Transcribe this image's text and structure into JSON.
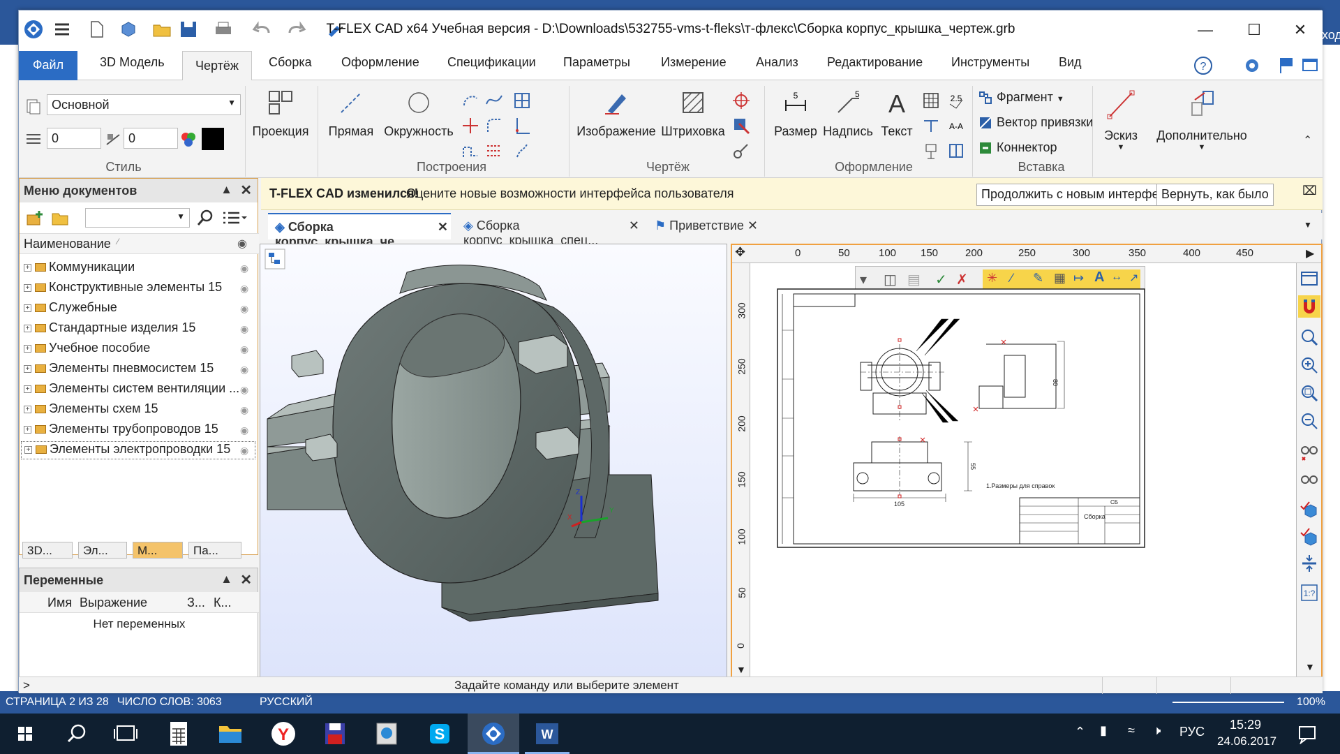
{
  "word": {
    "status_page": "СТРАНИЦА 2 ИЗ 28",
    "status_words": "ЧИСЛО СЛОВ: 3063",
    "status_lang": "РУССКИЙ",
    "zoom": "100%",
    "right_fragment": "ход"
  },
  "app": {
    "title": "T-FLEX CAD x64 Учебная версия - D:\\Downloads\\532755-vms-t-fleks\\т-флекс\\Сборка корпус_крышка_чертеж.grb"
  },
  "menu_tabs": [
    "Файл",
    "3D Модель",
    "Чертёж",
    "Сборка",
    "Оформление",
    "Спецификации",
    "Параметры",
    "Измерение",
    "Анализ",
    "Редактирование",
    "Инструменты",
    "Вид"
  ],
  "ribbon": {
    "style_combo": "Основной",
    "spin1": "0",
    "spin2": "0",
    "group_style": "Стиль",
    "projection": "Проекция",
    "line": "Прямая",
    "circle": "Окружность",
    "group_build": "Построения",
    "image": "Изображение",
    "hatch": "Штриховка",
    "group_drawing": "Чертёж",
    "size": "Размер",
    "label": "Надпись",
    "text": "Текст",
    "group_format": "Оформление",
    "fragment": "Фрагмент",
    "vector": "Вектор привязки",
    "connector": "Коннектор",
    "group_insert": "Вставка",
    "sketch": "Эскиз",
    "more": "Дополнительно"
  },
  "notify": {
    "bold": "T-FLEX CAD изменился!",
    "text": "Оцените новые возможности интерфейса пользователя",
    "btn_continue": "Продолжить с новым интерфейсом",
    "btn_revert": "Вернуть, как было"
  },
  "doc_tabs": [
    "Сборка корпус_крышка_че...",
    "Сборка корпус_крышка_спец...",
    "Приветствие"
  ],
  "docs_panel": {
    "title": "Меню документов",
    "col_name": "Наименование",
    "items": [
      "Коммуникации",
      "Конструктивные элементы 15",
      "Служебные",
      "Стандартные изделия 15",
      "Учебное пособие",
      "Элементы пневмосистем 15",
      "Элементы систем вентиляции ...",
      "Элементы схем 15",
      "Элементы трубопроводов 15",
      "Элементы электропроводки 15"
    ],
    "bottom_tabs": [
      "3D...",
      "Эл...",
      "М...",
      "Па..."
    ]
  },
  "vars_panel": {
    "title": "Переменные",
    "cols": [
      "Имя",
      "Выражение",
      "З...",
      "К..."
    ],
    "empty": "Нет переменных"
  },
  "ruler": {
    "h": [
      "0",
      "50",
      "100",
      "150",
      "200",
      "250",
      "300",
      "350",
      "400",
      "450"
    ],
    "v": [
      "300",
      "250",
      "200",
      "150",
      "100",
      "50",
      "0"
    ]
  },
  "drawing": {
    "stamp_title": "Сборка",
    "stamp_code": "СБ",
    "note": "1.Размеры для справок",
    "dim_105": "105",
    "dim_80": "80",
    "dim_55": "55"
  },
  "cmdbar": {
    "prompt": "Задайте команду или выберите элемент",
    "caret": ">"
  },
  "taskbar": {
    "lang": "РУС",
    "time": "15:29",
    "date": "24.06.2017"
  }
}
